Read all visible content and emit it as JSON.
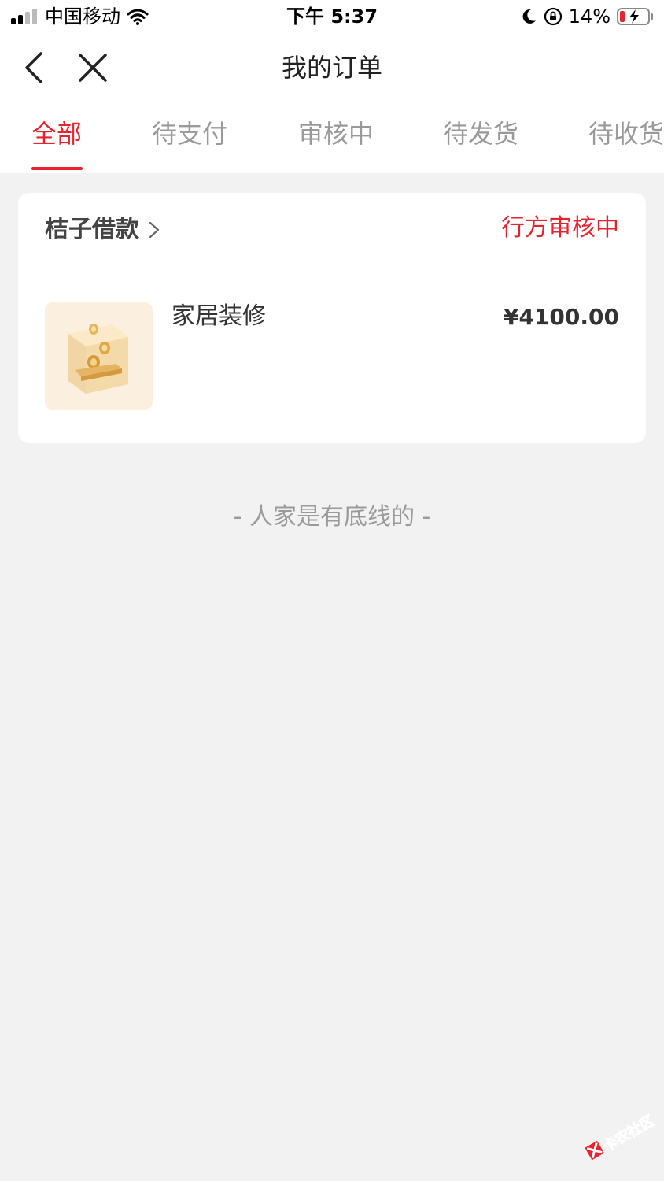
{
  "status_bar": {
    "carrier": "中国移动",
    "time": "下午 5:37",
    "battery": "14%",
    "icons": [
      "signal-icon",
      "wifi-icon",
      "moon-icon",
      "orientation-lock-icon",
      "battery-charging-icon"
    ]
  },
  "nav": {
    "title": "我的订单",
    "back_icon": "chevron-left-icon",
    "close_icon": "close-icon"
  },
  "tabs": [
    {
      "label": "全部",
      "active": true
    },
    {
      "label": "待支付",
      "active": false
    },
    {
      "label": "审核中",
      "active": false
    },
    {
      "label": "待发货",
      "active": false
    },
    {
      "label": "待收货",
      "active": false
    }
  ],
  "order": {
    "merchant": "桔子借款",
    "status": "行方审核中",
    "product_name": "家居装修",
    "price": "¥4100.00"
  },
  "footer_note": "- 人家是有底线的 -",
  "watermark": "卡农社区",
  "colors": {
    "accent": "#e8232e",
    "background": "#f2f2f2",
    "card": "#ffffff"
  }
}
